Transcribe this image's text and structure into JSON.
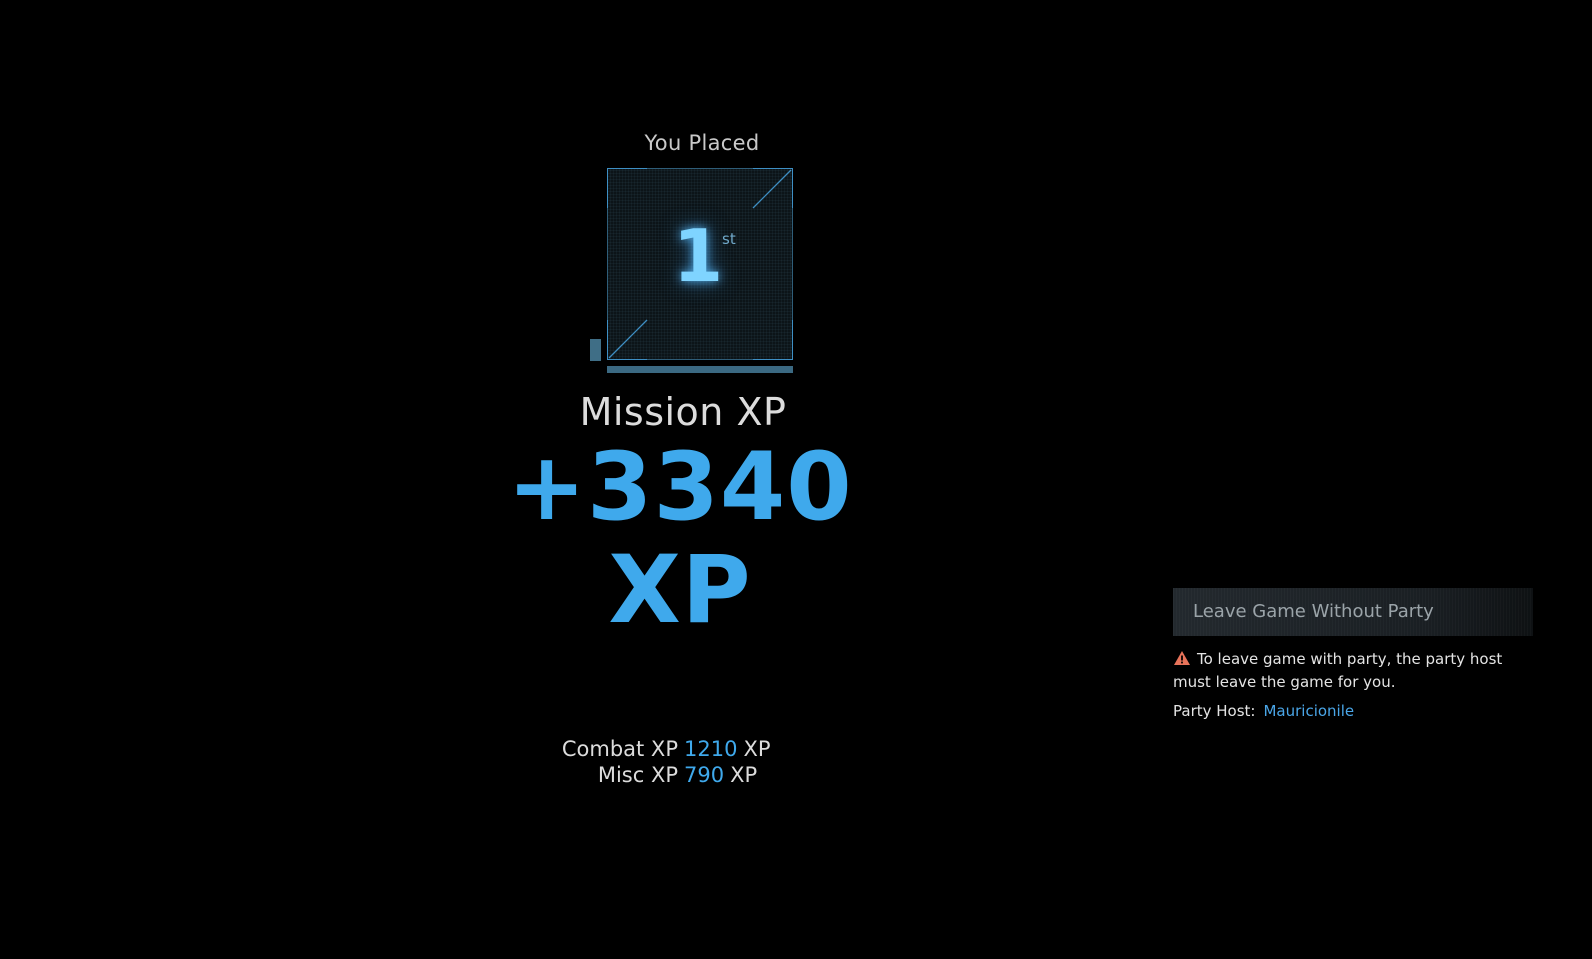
{
  "placement": {
    "title": "You Placed",
    "rank": "1",
    "suffix": "st"
  },
  "mission_xp": {
    "label": "Mission XP",
    "value": "+3340 XP"
  },
  "breakdown": [
    {
      "label": "Combat XP",
      "value": "1210",
      "unit": "XP"
    },
    {
      "label": "Misc XP",
      "value": "790",
      "unit": "XP"
    }
  ],
  "side_panel": {
    "leave_button_label": "Leave Game Without Party",
    "warning_icon": "warning-triangle-icon",
    "warning_text": "To leave game with party, the party host must leave the game for you.",
    "host_label": "Party Host:",
    "host_name": "Mauricionile"
  },
  "colors": {
    "accent_blue": "#3fa9ec",
    "glow_blue": "#7fd4ff",
    "warning_orange": "#e8735a",
    "background": "#000000"
  }
}
